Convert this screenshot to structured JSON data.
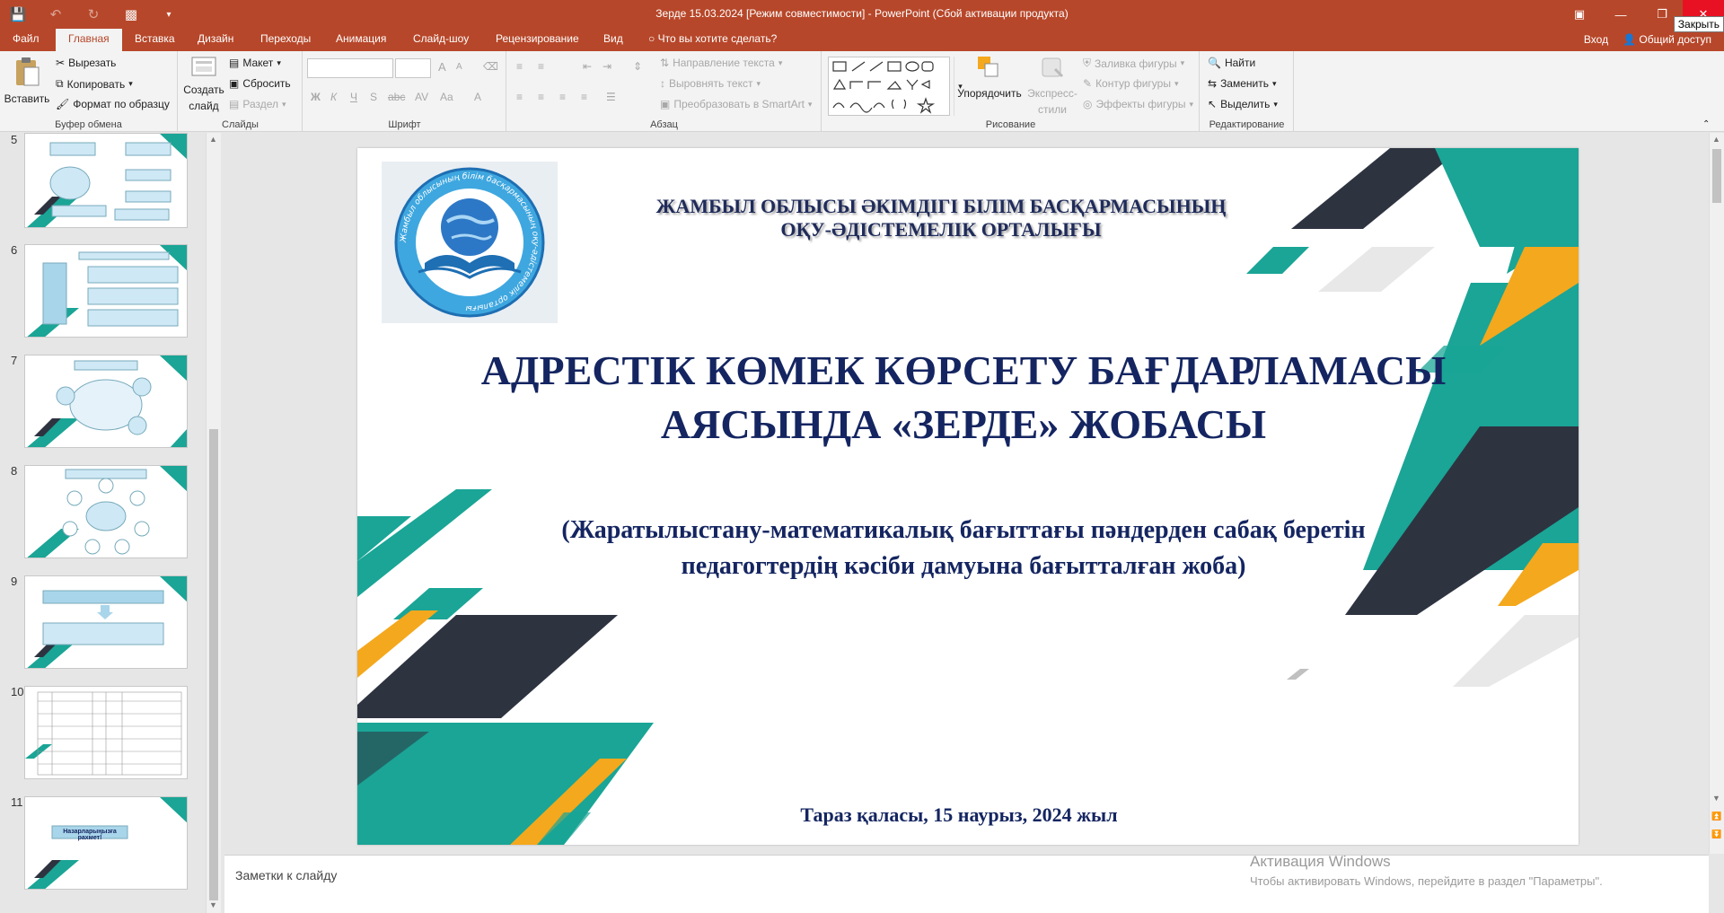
{
  "window": {
    "title": "Зерде 15.03.2024 [Режим совместимости] - PowerPoint (Сбой активации продукта)",
    "close_tooltip": "Закрыть"
  },
  "tabs": [
    {
      "label": "Файл"
    },
    {
      "label": "Главная"
    },
    {
      "label": "Вставка"
    },
    {
      "label": "Дизайн"
    },
    {
      "label": "Переходы"
    },
    {
      "label": "Анимация"
    },
    {
      "label": "Слайд-шоу"
    },
    {
      "label": "Рецензирование"
    },
    {
      "label": "Вид"
    },
    {
      "label": "Что вы хотите сделать?"
    }
  ],
  "account": {
    "signin": "Вход",
    "share": "Общий доступ"
  },
  "ribbon": {
    "clipboard": {
      "label": "Буфер обмена",
      "paste": "Вставить",
      "cut": "Вырезать",
      "copy": "Копировать",
      "format_painter": "Формат по образцу"
    },
    "slides": {
      "label": "Слайды",
      "new_slide_1": "Создать",
      "new_slide_2": "слайд",
      "layout": "Макет",
      "reset": "Сбросить",
      "section": "Раздел"
    },
    "font": {
      "label": "Шрифт",
      "bold": "Ж",
      "italic": "К",
      "underline": "Ч",
      "shadow": "S",
      "strike": "abc",
      "spacing": "AV",
      "case": "Aa",
      "grow": "A",
      "shrink": "A"
    },
    "paragraph": {
      "label": "Абзац",
      "text_direction": "Направление текста",
      "align_text": "Выровнять текст",
      "smartart": "Преобразовать в SmartArt"
    },
    "drawing": {
      "label": "Рисование",
      "arrange": "Упорядочить",
      "quick_styles_1": "Экспресс-",
      "quick_styles_2": "стили",
      "fill": "Заливка фигуры",
      "outline": "Контур фигуры",
      "effects": "Эффекты фигуры"
    },
    "editing": {
      "label": "Редактирование",
      "find": "Найти",
      "replace": "Заменить",
      "select": "Выделить"
    }
  },
  "thumbnails": [
    {
      "num": "5"
    },
    {
      "num": "6"
    },
    {
      "num": "7"
    },
    {
      "num": "8"
    },
    {
      "num": "9"
    },
    {
      "num": "10"
    },
    {
      "num": "11",
      "caption": "Назарларыңызға рахмет!"
    }
  ],
  "slide": {
    "org_line1": "ЖАМБЫЛ ОБЛЫСЫ ӘКІМДІГІ БІЛІМ БАСҚАРМАСЫНЫҢ",
    "org_line2": "ОҚУ-ӘДІСТЕМЕЛІК ОРТАЛЫҒЫ",
    "logo_ring_text": "Жамбыл облысының білім басқармасының оқу-әдістемелік орталығы",
    "title_line1": "АДРЕСТІК КӨМЕК КӨРСЕТУ БАҒДАРЛАМАСЫ",
    "title_line2": "АЯСЫНДА «ЗЕРДЕ» ЖОБАСЫ",
    "subtitle_line1": "(Жаратылыстану-математикалық бағыттағы пәндерден сабақ беретін",
    "subtitle_line2": "педагогтердің кәсіби дамуына бағытталған жоба)",
    "footer": "Тараз қаласы, 15 наурыз, 2024 жыл"
  },
  "notes": {
    "placeholder": "Заметки к слайду"
  },
  "activation": {
    "line1": "Активация Windows",
    "line2": "Чтобы активировать Windows, перейдите в раздел \"Параметры\"."
  },
  "colors": {
    "accent": "#b7472a",
    "teal": "#1aa596",
    "dark": "#2e3340",
    "orange": "#f4a81d",
    "navy": "#142561"
  }
}
